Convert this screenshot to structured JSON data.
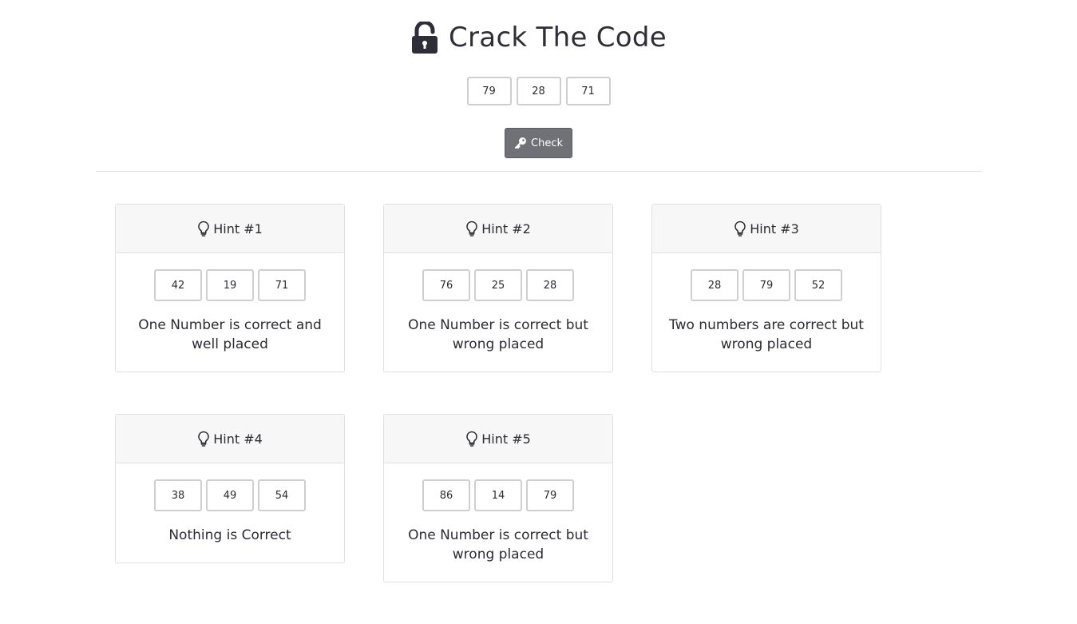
{
  "header": {
    "title": "Crack The Code",
    "icon": "lock-open-icon"
  },
  "code": {
    "values": [
      "79",
      "28",
      "71"
    ]
  },
  "check_button": {
    "label": "Check",
    "icon": "key-icon",
    "color": "#6f7176"
  },
  "hints": [
    {
      "title": "Hint #1",
      "numbers": [
        "42",
        "19",
        "71"
      ],
      "text": "One Number is correct and well placed"
    },
    {
      "title": "Hint #2",
      "numbers": [
        "76",
        "25",
        "28"
      ],
      "text": "One Number is correct but wrong placed"
    },
    {
      "title": "Hint #3",
      "numbers": [
        "28",
        "79",
        "52"
      ],
      "text": "Two numbers are correct but wrong placed"
    },
    {
      "title": "Hint #4",
      "numbers": [
        "38",
        "49",
        "54"
      ],
      "text": "Nothing is Correct"
    },
    {
      "title": "Hint #5",
      "numbers": [
        "86",
        "14",
        "79"
      ],
      "text": "One Number is correct but wrong placed"
    }
  ]
}
